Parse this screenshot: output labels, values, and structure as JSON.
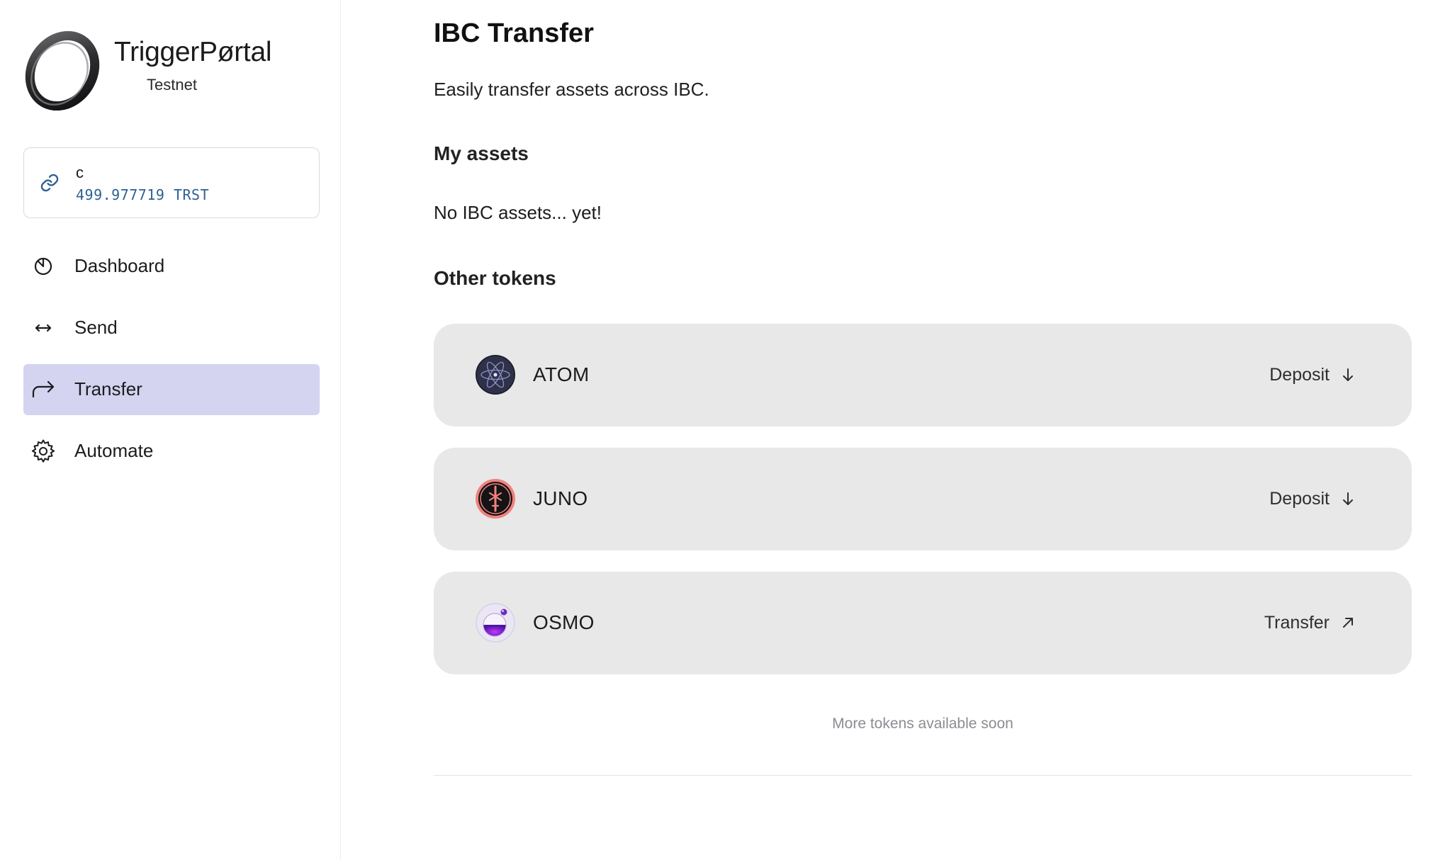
{
  "brand": {
    "name": "TriggerPørtal",
    "network": "Testnet"
  },
  "wallet": {
    "name": "c",
    "balance": "499.977719 TRST"
  },
  "nav": {
    "items": [
      {
        "label": "Dashboard",
        "icon": "dashboard-icon",
        "active": false
      },
      {
        "label": "Send",
        "icon": "arrows-horizontal-icon",
        "active": false
      },
      {
        "label": "Transfer",
        "icon": "share-arrow-icon",
        "active": true
      },
      {
        "label": "Automate",
        "icon": "gear-icon",
        "active": false
      }
    ]
  },
  "main": {
    "title": "IBC Transfer",
    "description": "Easily transfer assets across IBC.",
    "my_assets": {
      "heading": "My assets",
      "empty": "No IBC assets... yet!"
    },
    "other_tokens": {
      "heading": "Other tokens",
      "tokens": [
        {
          "symbol": "ATOM",
          "action": "Deposit",
          "action_icon": "arrow-down-icon",
          "logo": "cosmos-atom-logo"
        },
        {
          "symbol": "JUNO",
          "action": "Deposit",
          "action_icon": "arrow-down-icon",
          "logo": "juno-logo"
        },
        {
          "symbol": "OSMO",
          "action": "Transfer",
          "action_icon": "arrow-up-right-icon",
          "logo": "osmosis-logo"
        }
      ]
    },
    "more_tokens": "More tokens available soon"
  },
  "colors": {
    "active_nav_bg": "#d4d3f0",
    "card_bg": "#e8e8e9",
    "balance_text": "#2e5f92"
  }
}
